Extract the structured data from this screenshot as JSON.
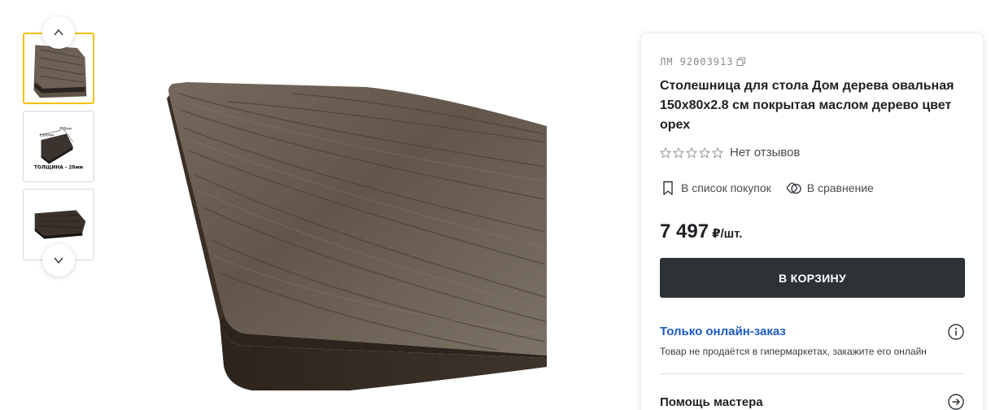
{
  "gallery": {
    "prev_icon": "chevron-up-icon",
    "next_icon": "chevron-down-icon",
    "thumbnails": [
      {
        "icon": "tabletop-photo",
        "active": true
      },
      {
        "icon": "tabletop-dimensions-drawing",
        "active": false,
        "dims_width": "1500мм",
        "dims_depth": "800мм",
        "caption": "ТОЛЩИНА - 28мм"
      },
      {
        "icon": "tabletop-photo-dark",
        "active": false
      }
    ]
  },
  "product": {
    "sku_label": "ЛМ 92003913",
    "title": "Столешница для стола Дом дерева овальная 150x80x2.8 см покрытая маслом дерево цвет орех",
    "rating": 0,
    "reviews_text": "Нет отзывов",
    "shopping_list_label": "В список покупок",
    "compare_label": "В сравнение",
    "price": "7 497",
    "price_unit": "₽/шт.",
    "cart_button": "В КОРЗИНУ",
    "online_only_title": "Только онлайн-заказ",
    "online_only_desc": "Товар не продаётся в гипермаркетах, закажите его онлайн",
    "help_title": "Помощь мастера"
  },
  "colors": {
    "accent_yellow": "#f2c10f",
    "button_dark": "#2d3237",
    "link_blue": "#1d5bbf"
  }
}
